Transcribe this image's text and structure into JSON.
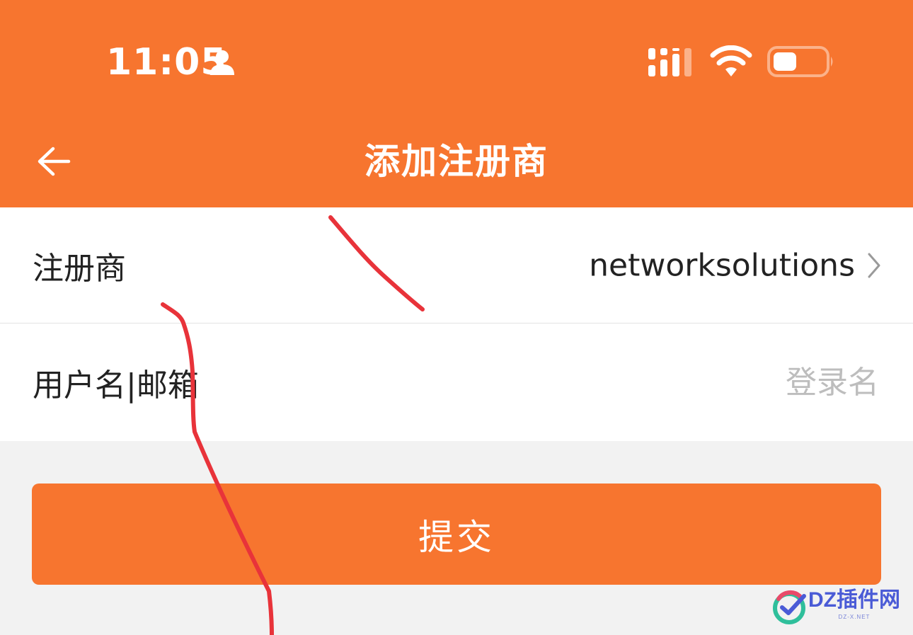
{
  "status_bar": {
    "time": "11:05",
    "icons": [
      "person-icon",
      "cellular-signal-icon",
      "wifi-icon",
      "battery-icon"
    ]
  },
  "nav": {
    "back_icon": "arrow-left-icon",
    "title": "添加注册商"
  },
  "form": {
    "registrar": {
      "label": "注册商",
      "value": "networksolutions",
      "chevron_icon": "chevron-right-icon"
    },
    "username": {
      "label": "用户名|邮箱",
      "placeholder": "登录名",
      "value": ""
    }
  },
  "submit": {
    "label": "提交"
  },
  "watermark": {
    "text": "DZ插件网",
    "subtext": "DZ-X.NET"
  },
  "colors": {
    "accent": "#f7752f",
    "background": "#f2f2f2",
    "annotation": "#e8333a"
  }
}
